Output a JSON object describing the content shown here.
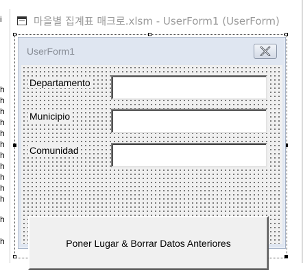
{
  "code_window": {
    "margin_chars": [
      "i",
      "h",
      "h",
      "h",
      "h",
      "h",
      "h",
      "h",
      "h",
      "h",
      "h",
      "h",
      "h",
      "h"
    ]
  },
  "designer_window": {
    "title": "마을별 집계표 매크로.xlsm - UserForm1 (UserForm)"
  },
  "userform": {
    "caption": "UserForm1",
    "fields": [
      {
        "label": "Departamento",
        "value": ""
      },
      {
        "label": "Municipio",
        "value": ""
      },
      {
        "label": "Comunidad",
        "value": ""
      }
    ],
    "button_label": "Poner Lugar & Borrar Datos Anteriores"
  }
}
